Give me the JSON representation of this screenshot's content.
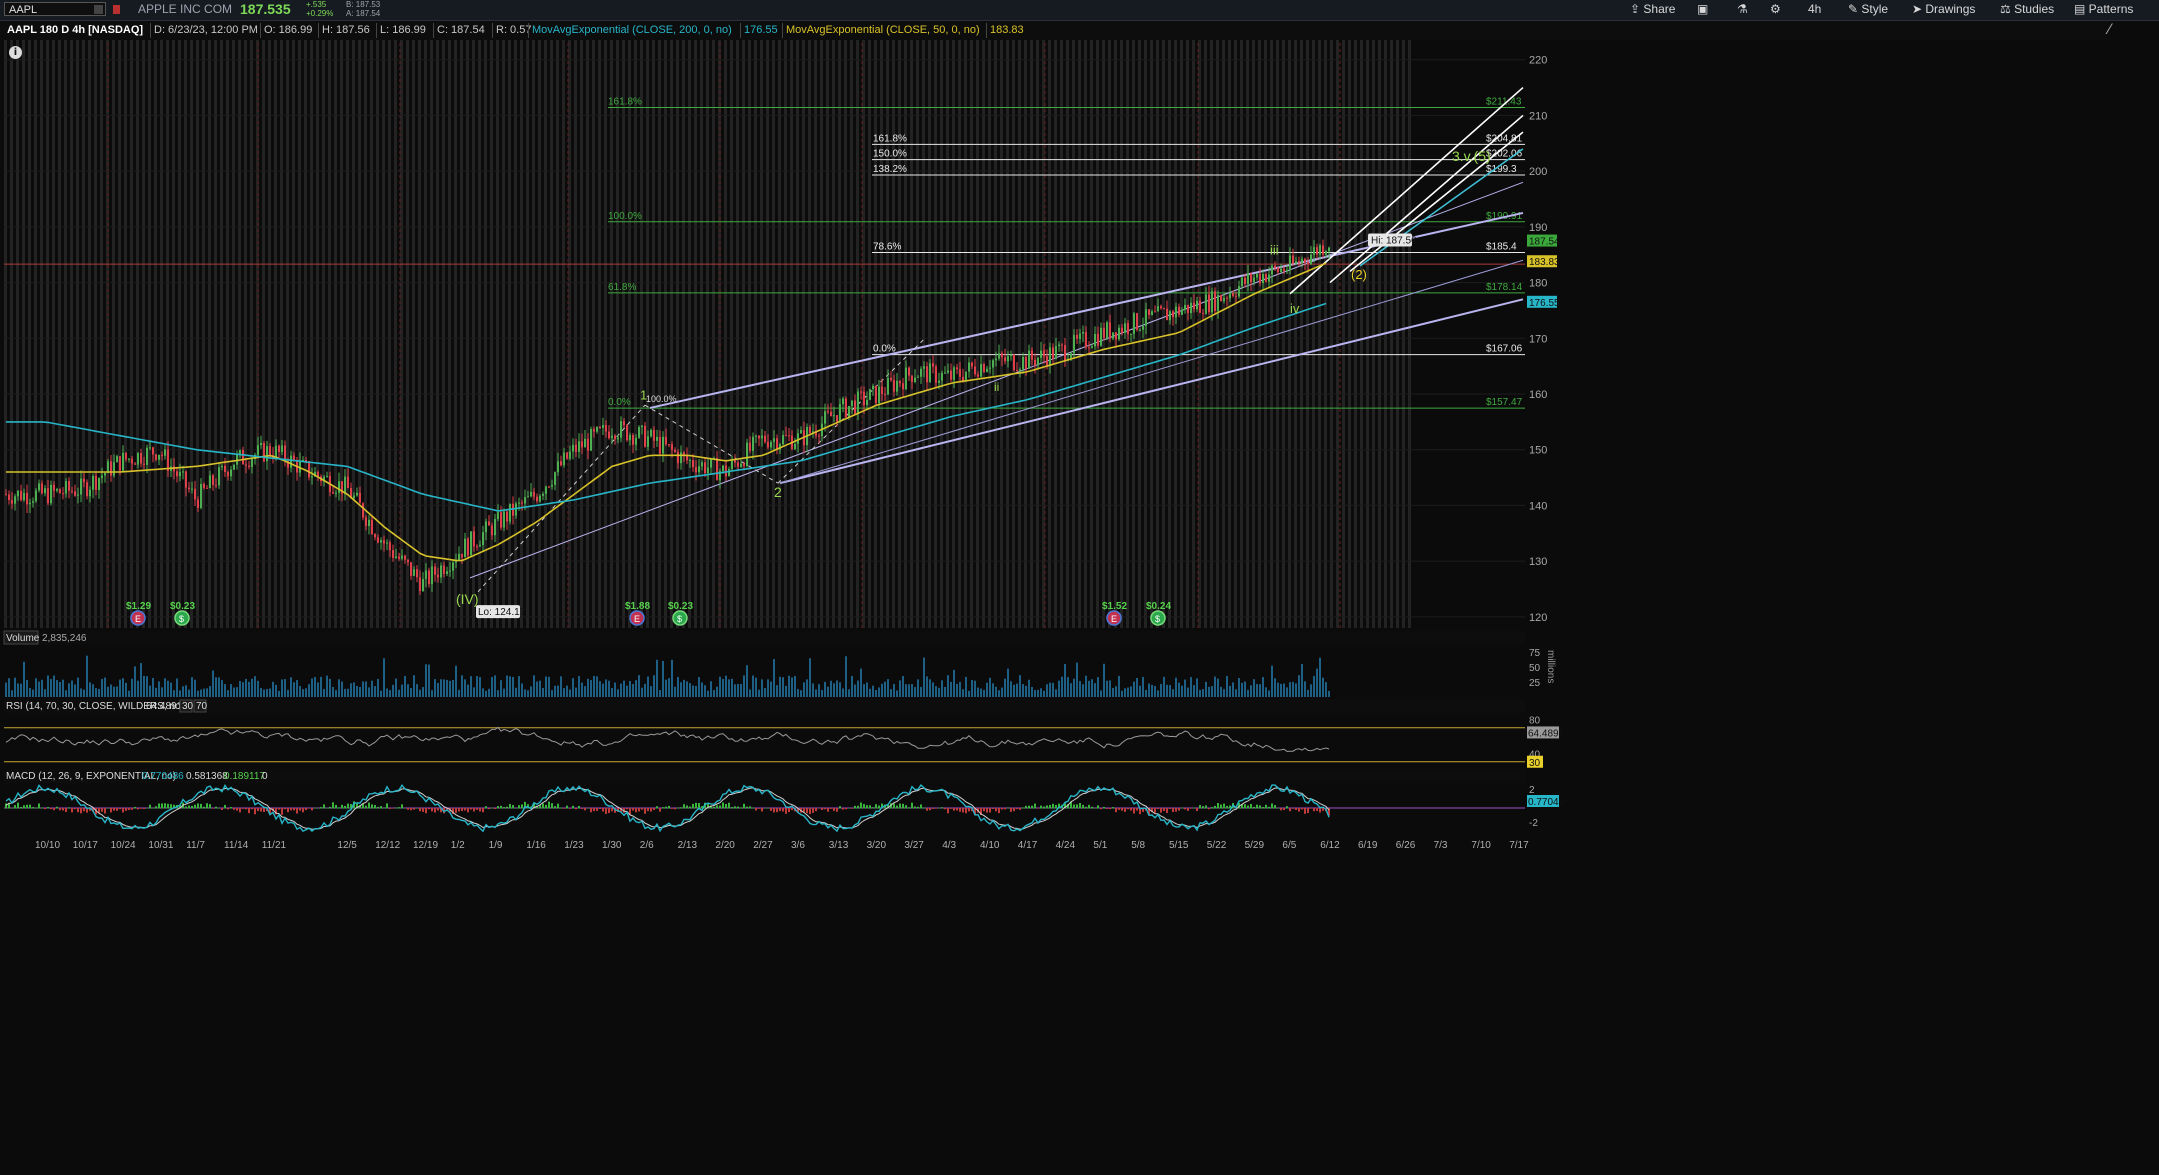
{
  "toolbar": {
    "symbol": "AAPL",
    "company": "APPLE INC COM",
    "last": "187.535",
    "change": "+.535",
    "change_pct": "+0.29%",
    "bid": "B: 187.53",
    "ask": "A: 187.54",
    "buttons": [
      "Share",
      "4h",
      "Style",
      "Drawings",
      "Studies",
      "Patterns"
    ]
  },
  "infobar": {
    "chart_title": "AAPL 180 D 4h [NASDAQ]",
    "date": "D: 6/23/23, 12:00 PM",
    "open": "O: 186.99",
    "high": "H: 187.56",
    "low": "L: 186.99",
    "close": "C: 187.54",
    "range": "R: 0.57",
    "ema200_label": "MovAvgExponential (CLOSE, 200, 0, no)",
    "ema200_value": "176.55",
    "ema50_label": "MovAvgExponential (CLOSE, 50, 0, no)",
    "ema50_value": "183.83"
  },
  "colors": {
    "background": "#0b0b0b",
    "up_candle": "#4caf50",
    "down_candle": "#e0404a",
    "ema200": "#27b5c8",
    "ema50": "#d8c22a",
    "fib_green": "#3faa3f",
    "fib_white": "#e8e8e8",
    "channel": "#b9b4f0",
    "price_line_red": "#b03a3a"
  },
  "chart_data": [
    {
      "type": "line",
      "name": "price",
      "x_labels": [
        "10/10",
        "10/17",
        "10/24",
        "10/31",
        "11/7",
        "11/14",
        "11/21",
        "12/5",
        "12/12",
        "12/19",
        "1/2",
        "1/9",
        "1/16",
        "1/23",
        "1/30",
        "2/6",
        "2/13",
        "2/20",
        "2/27",
        "3/6",
        "3/13",
        "3/20",
        "3/27",
        "4/3",
        "4/10",
        "4/17",
        "4/24",
        "5/1",
        "5/8",
        "5/15",
        "5/22",
        "5/29",
        "6/5",
        "6/12",
        "6/19",
        "6/26",
        "7/3",
        "7/10",
        "7/17"
      ],
      "y_ticks": [
        120,
        130,
        140,
        150,
        160,
        170,
        180,
        190,
        200,
        210,
        220
      ],
      "ylim": [
        118,
        223
      ],
      "series": [
        {
          "name": "AAPL",
          "x": [
            0,
            1,
            2,
            3,
            4,
            5,
            6,
            7,
            8,
            9,
            10,
            11,
            12,
            13,
            14,
            15,
            16,
            17,
            18,
            19,
            20,
            21,
            22,
            23,
            24,
            25,
            26,
            27,
            28,
            29,
            30,
            31,
            32,
            33,
            34
          ],
          "y": [
            142,
            143,
            148,
            150,
            141,
            148,
            150,
            146,
            143,
            133,
            126,
            132,
            137,
            142,
            150,
            154,
            152,
            148,
            146,
            152,
            152,
            157,
            160,
            164,
            163,
            166,
            166,
            168,
            171,
            173,
            175,
            177,
            181,
            183,
            187.5
          ]
        },
        {
          "name": "MovAvgExponential (CLOSE, 50, 0, no)",
          "x": [
            0,
            2,
            4,
            6,
            7,
            8,
            9,
            10,
            11,
            12,
            13,
            14,
            15,
            16,
            17,
            18,
            19,
            20,
            22,
            24,
            26,
            28,
            30,
            32,
            34
          ],
          "y": [
            146,
            146,
            147,
            149,
            146,
            142,
            136,
            131,
            130,
            133,
            137,
            142,
            147,
            149,
            149,
            148,
            149,
            152,
            158,
            162,
            164,
            168,
            171,
            178,
            183.8
          ]
        },
        {
          "name": "MovAvgExponential (CLOSE, 200, 0, no)",
          "x": [
            0,
            4,
            8,
            10,
            12,
            14,
            16,
            18,
            20,
            22,
            24,
            26,
            28,
            30,
            32,
            34
          ],
          "y": [
            155,
            150,
            147,
            142,
            139,
            141,
            144,
            146,
            148,
            152,
            156,
            159,
            163,
            167,
            172,
            176.5
          ]
        }
      ],
      "fib_levels": [
        {
          "label": "161.8%",
          "value": "$211.43",
          "price": 211.43
        },
        {
          "label": "100.0%",
          "value": "$190.91",
          "price": 190.91
        },
        {
          "label": "61.8%",
          "value": "$178.14",
          "price": 178.14
        },
        {
          "label": "0.0%",
          "value": "$157.47",
          "price": 157.47
        }
      ],
      "fib_levels_2": [
        {
          "label": "161.8%",
          "value": "$204.81",
          "price": 204.81
        },
        {
          "label": "150.0%",
          "value": "$202.06",
          "price": 202.06
        },
        {
          "label": "138.2%",
          "value": "$199.3",
          "price": 199.3
        },
        {
          "label": "78.6%",
          "value": "$185.4",
          "price": 185.4
        },
        {
          "label": "0.0%",
          "value": "$167.06",
          "price": 167.06
        }
      ],
      "price_tags": [
        {
          "value": "187.54",
          "price": 187.54,
          "color": "#3aa83a"
        },
        {
          "value": "183.83",
          "price": 183.83,
          "color": "#d8c22a"
        },
        {
          "value": "176.55",
          "price": 176.55,
          "color": "#27b5c8"
        }
      ],
      "annotations": [
        "(IV)",
        "1",
        "2",
        "ii",
        "iii",
        "iv",
        "(2)",
        "3.v.(5)",
        "100.0%"
      ],
      "hi_label": "Hi: 187.56",
      "lo_label": "Lo: 124.17",
      "events": [
        {
          "type": "earnings",
          "label": "$1.29"
        },
        {
          "type": "dividend",
          "label": "$0.23"
        },
        {
          "type": "earnings",
          "label": "$1.88"
        },
        {
          "type": "dividend",
          "label": "$0.23"
        },
        {
          "type": "earnings",
          "label": "$1.52"
        },
        {
          "type": "dividend",
          "label": "$0.24"
        }
      ]
    },
    {
      "type": "bar",
      "name": "volume",
      "label": "Volume",
      "value": "2,835,246",
      "y_ticks": [
        25,
        50,
        75
      ],
      "ylabel": "millions"
    },
    {
      "type": "line",
      "name": "rsi",
      "label": "RSI (14, 70, 30, CLOSE, WILDERS, no)",
      "value": "64.4891",
      "levels": [
        "30",
        "70"
      ],
      "y_ticks": [
        40,
        80
      ],
      "tag_value": "64.4891",
      "tag_low": "30"
    },
    {
      "type": "line",
      "name": "macd",
      "label": "MACD (12, 26, 9, EXPONENTIAL, no)",
      "values": [
        "0.770486",
        "0.581368",
        "0.189117",
        "0"
      ],
      "y_ticks": [
        "2",
        "-2"
      ],
      "tag_value": "0.77049"
    }
  ]
}
